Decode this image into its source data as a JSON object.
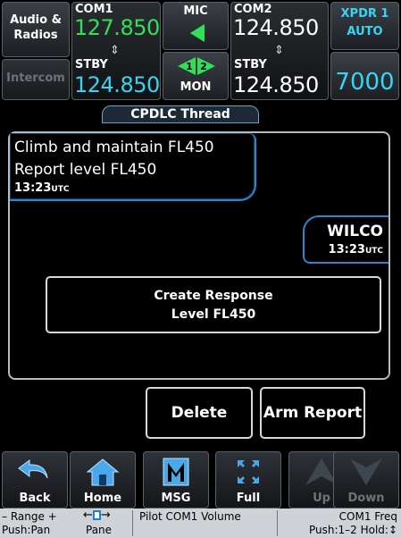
{
  "top_bar": {
    "audio_label_1": "Audio &",
    "audio_label_2": "Radios",
    "intercom_label": "Intercom",
    "com1": {
      "label": "COM1",
      "active": "127.850",
      "stby_label": "STBY",
      "standby": "124.850"
    },
    "mic_label": "MIC",
    "mon": {
      "label": "MON",
      "badge_1": "1",
      "badge_2": "2"
    },
    "com2": {
      "label": "COM2",
      "active": "124.850",
      "stby_label": "STBY",
      "standby": "124.850"
    },
    "xpdr": {
      "label": "XPDR 1",
      "mode": "AUTO",
      "code": "7000"
    },
    "icons": {
      "swap": "swap-arrow-icon",
      "mic": "mic-triangle-icon"
    }
  },
  "page_title": "CPDLC Thread",
  "thread": {
    "uplink": {
      "line_1": "Climb and maintain FL450",
      "line_2": "Report level FL450",
      "time": "13:23",
      "tz": "UTC"
    },
    "downlink": {
      "line_1": "WILCO",
      "time": "13:23",
      "tz": "UTC"
    },
    "create_response": {
      "line_1": "Create Response",
      "line_2": "Level FL450"
    }
  },
  "actions": {
    "delete": "Delete",
    "arm_report": "Arm Report"
  },
  "softkeys": [
    {
      "label": "Back",
      "icon": "back-arrow-icon"
    },
    {
      "label": "Home",
      "icon": "home-icon"
    },
    {
      "label": "MSG",
      "icon": "msg-icon"
    },
    {
      "label": "Full",
      "icon": "full-screen-icon"
    },
    {
      "label": "Up",
      "icon": "up-arrow-icon"
    },
    {
      "label": "Down",
      "icon": "down-arrow-icon"
    }
  ],
  "legend": {
    "range_1": "– Range +",
    "range_2": "Push:Pan",
    "pane": "Pane",
    "volume": "Pilot COM1 Volume",
    "com_freq_1": "COM1 Freq",
    "com_freq_2": "Push:1–2 Hold:↕"
  },
  "colors": {
    "active_freq": "#2fe05a",
    "standby_freq": "#38d4f5",
    "bubble_border": "#2c86c9",
    "legend_bg": "#cfd2d6"
  }
}
